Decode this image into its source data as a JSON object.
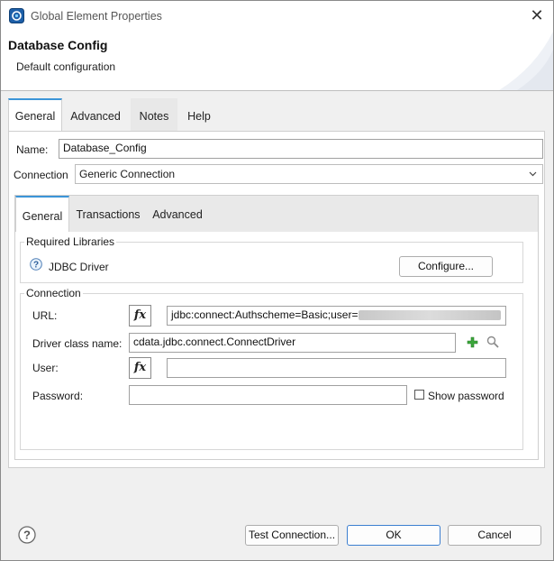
{
  "window": {
    "title": "Global Element Properties",
    "close_glyph": "✕"
  },
  "header": {
    "title": "Database Config",
    "description": "Default configuration"
  },
  "tabs": [
    {
      "label": "General",
      "active": true
    },
    {
      "label": "Advanced",
      "active": false
    },
    {
      "label": "Notes",
      "active": false
    },
    {
      "label": "Help",
      "active": false
    }
  ],
  "form": {
    "name_label": "Name:",
    "name_value": "Database_Config",
    "connection_label": "Connection",
    "connection_value": "Generic Connection"
  },
  "inner_tabs": [
    {
      "label": "General",
      "active": true
    },
    {
      "label": "Transactions",
      "active": false
    },
    {
      "label": "Advanced",
      "active": false
    }
  ],
  "required_libraries": {
    "title": "Required Libraries",
    "item_label": "JDBC Driver",
    "configure_label": "Configure..."
  },
  "connection_group": {
    "title": "Connection",
    "url_label": "URL:",
    "url_value": "jdbc:connect:Authscheme=Basic;user=",
    "driver_label": "Driver class name:",
    "driver_value": "cdata.jdbc.connect.ConnectDriver",
    "user_label": "User:",
    "user_value": "",
    "password_label": "Password:",
    "password_value": "",
    "show_password_label": "Show password",
    "show_password_checked": false,
    "fx_label": "fx"
  },
  "footer": {
    "test_connection_label": "Test Connection...",
    "ok_label": "OK",
    "cancel_label": "Cancel"
  },
  "colors": {
    "accent": "#3c95d8",
    "plus_green": "#3aa63a"
  }
}
